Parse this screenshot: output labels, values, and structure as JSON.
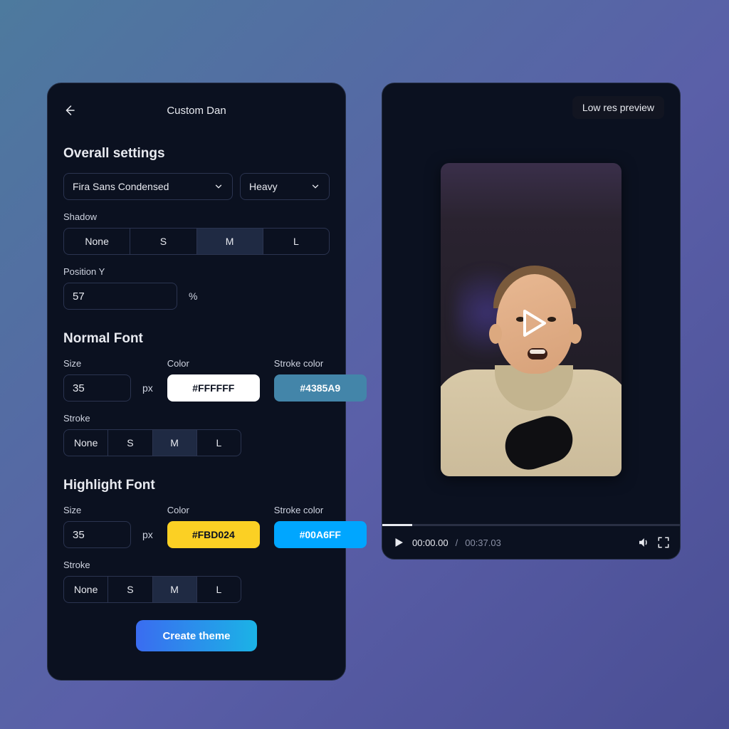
{
  "header": {
    "title": "Custom Dan"
  },
  "overall": {
    "heading": "Overall settings",
    "font_family": "Fira Sans Condensed",
    "font_weight": "Heavy",
    "shadow_label": "Shadow",
    "shadow_options": [
      "None",
      "S",
      "M",
      "L"
    ],
    "shadow_selected": "M",
    "position_y_label": "Position Y",
    "position_y_value": "57",
    "position_y_unit": "%"
  },
  "normal": {
    "heading": "Normal Font",
    "size_label": "Size",
    "size_value": "35",
    "size_unit": "px",
    "color_label": "Color",
    "color_value": "#FFFFFF",
    "stroke_color_label": "Stroke color",
    "stroke_color_value": "#4385A9",
    "stroke_label": "Stroke",
    "stroke_options": [
      "None",
      "S",
      "M",
      "L"
    ],
    "stroke_selected": "M"
  },
  "highlight": {
    "heading": "Highlight Font",
    "size_label": "Size",
    "size_value": "35",
    "size_unit": "px",
    "color_label": "Color",
    "color_value": "#FBD024",
    "stroke_color_label": "Stroke color",
    "stroke_color_value": "#00A6FF",
    "stroke_label": "Stroke",
    "stroke_options": [
      "None",
      "S",
      "M",
      "L"
    ],
    "stroke_selected": "M"
  },
  "cta_label": "Create theme",
  "preview": {
    "badge": "Low res preview",
    "current_time": "00:00.00",
    "separator": "/",
    "duration": "00:37.03"
  },
  "colors": {
    "accent_blue": "#00A6FF",
    "accent_teal": "#4385A9",
    "accent_yellow": "#FBD024"
  }
}
